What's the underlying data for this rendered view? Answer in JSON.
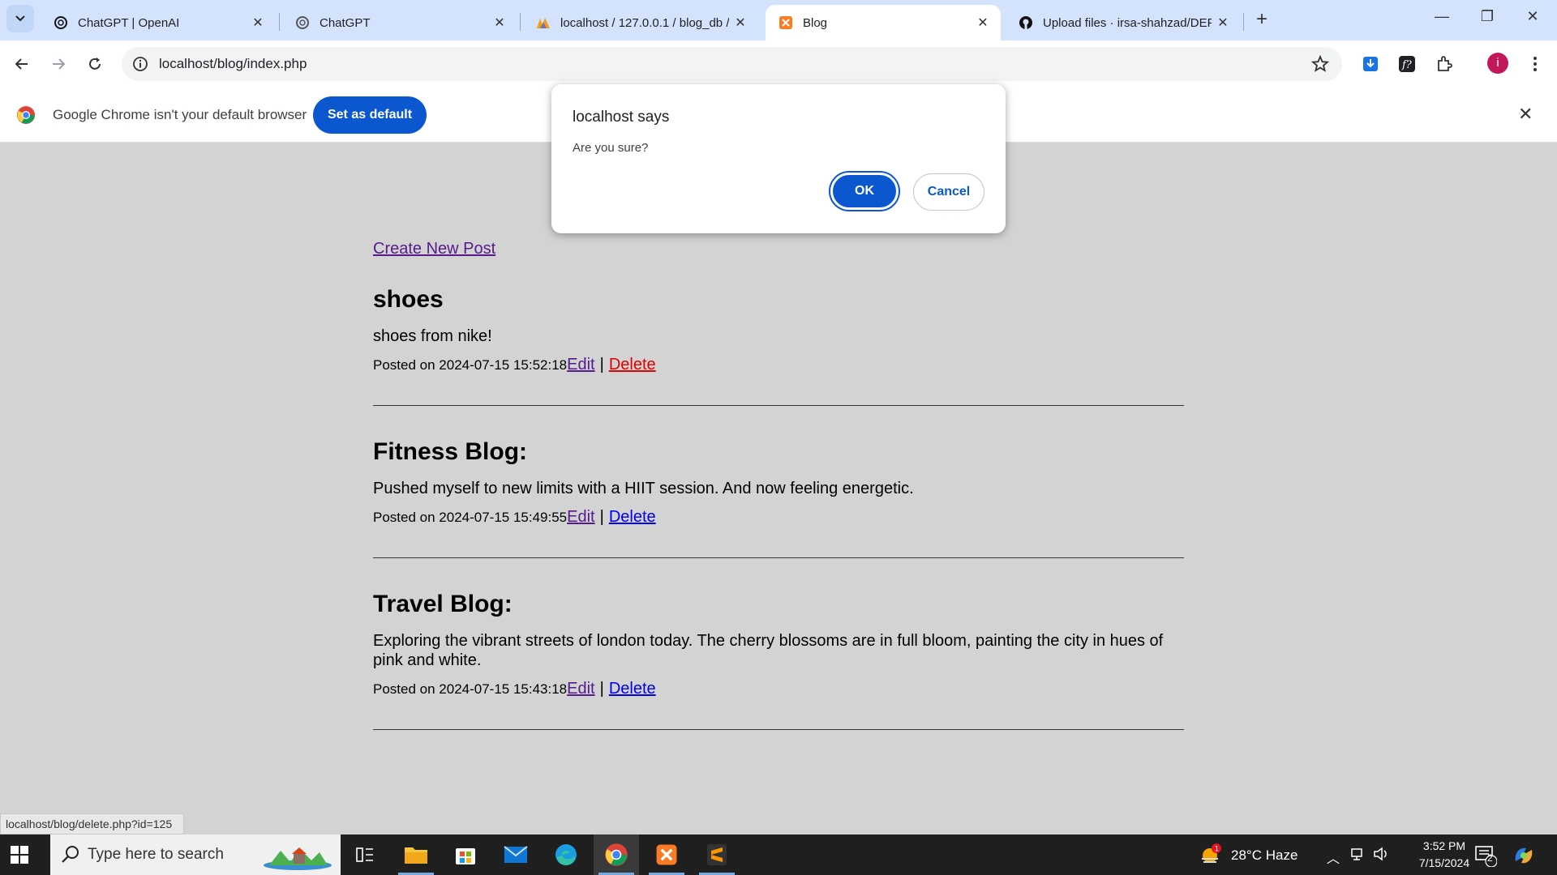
{
  "browser": {
    "tabs": [
      {
        "title": "ChatGPT | OpenAI",
        "icon": "openai-icon"
      },
      {
        "title": "ChatGPT",
        "icon": "openai-icon"
      },
      {
        "title": "localhost / 127.0.0.1 / blog_db /",
        "icon": "phpmyadmin-icon"
      },
      {
        "title": "Blog",
        "icon": "xampp-icon",
        "active": true
      },
      {
        "title": "Upload files · irsa-shahzad/DEP",
        "icon": "github-icon"
      }
    ],
    "url": "localhost/blog/index.php",
    "profile_initial": "i"
  },
  "infobar": {
    "message": "Google Chrome isn't your default browser",
    "button": "Set as default"
  },
  "dialog": {
    "title": "localhost says",
    "message": "Are you sure?",
    "ok": "OK",
    "cancel": "Cancel"
  },
  "page": {
    "create_link": "Create New Post",
    "posts": [
      {
        "title": "shoes",
        "body": "shoes from nike!",
        "posted": "Posted on 2024-07-15 15:52:18",
        "edit": "Edit",
        "sep": "|",
        "delete": "Delete"
      },
      {
        "title": "Fitness Blog:",
        "body": "Pushed myself to new limits with a HIIT session. And now feeling energetic.",
        "posted": "Posted on 2024-07-15 15:49:55",
        "edit": "Edit",
        "sep": "|",
        "delete": "Delete"
      },
      {
        "title": "Travel Blog:",
        "body": "Exploring the vibrant streets of london today. The cherry blossoms are in full bloom, painting the city in hues of pink and white.",
        "posted": "Posted on 2024-07-15 15:43:18",
        "edit": "Edit",
        "sep": "|",
        "delete": "Delete"
      }
    ]
  },
  "status_url": "localhost/blog/delete.php?id=125",
  "taskbar": {
    "search_placeholder": "Type here to search",
    "weather": "28°C  Haze",
    "weather_badge": "1",
    "time": "3:52 PM",
    "date": "7/15/2024",
    "notifications": "2"
  },
  "colors": {
    "accent": "#0b57d0",
    "page_bg": "#d3d3d3",
    "visited_link": "#551a8b",
    "link": "#0000ee",
    "hover_link": "#e00000"
  }
}
